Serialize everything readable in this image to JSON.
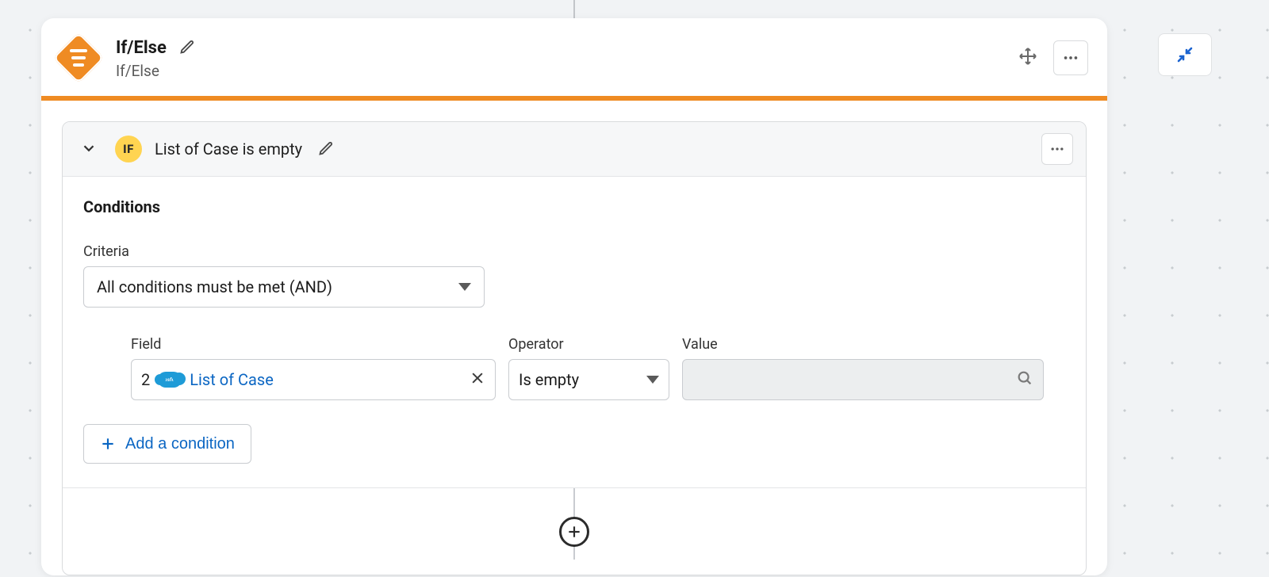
{
  "header": {
    "title": "If/Else",
    "subtitle": "If/Else"
  },
  "branch": {
    "badge": "IF",
    "title": "List of Case is empty"
  },
  "conditions": {
    "heading": "Conditions",
    "criteria_label": "Criteria",
    "criteria_value": "All conditions must be met (AND)",
    "field_label": "Field",
    "operator_label": "Operator",
    "value_label": "Value",
    "row": {
      "step_number": "2",
      "source_icon": "salesforce",
      "source_icon_text": "salesforce",
      "field_name": "List of Case",
      "operator": "Is empty"
    },
    "add_label": "Add a condition"
  }
}
